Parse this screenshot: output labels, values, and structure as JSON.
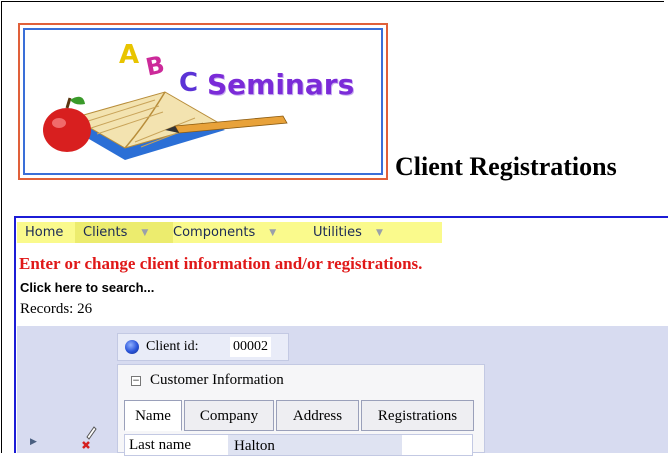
{
  "logo": {
    "letters": [
      "A",
      "B",
      "C"
    ],
    "brand": "Seminars",
    "colors": {
      "a": "#e8c400",
      "b": "#cc2a9a",
      "c": "#5b33d6",
      "brand": "#7b2bd8",
      "border_outer": "#e0603a",
      "border_inner": "#3a6fd8"
    }
  },
  "page_title": "Client Registrations",
  "menu": {
    "items": [
      {
        "label": "Home",
        "has_dropdown": false
      },
      {
        "label": "Clients",
        "has_dropdown": true,
        "selected": true
      },
      {
        "label": "Components",
        "has_dropdown": true
      },
      {
        "label": "Utilities",
        "has_dropdown": true
      }
    ],
    "dropdown_glyph": "▼",
    "background": "#fafa8c"
  },
  "instructions": "Enter or change client information and/or registrations.",
  "search_link": "Click here to search...",
  "records": {
    "label": "Records:",
    "count": "26"
  },
  "record": {
    "client_id_label": "Client id:",
    "client_id_value": "00002",
    "panel": {
      "title": "Customer Information",
      "collapse_glyph": "−",
      "tabs": [
        "Name",
        "Company",
        "Address",
        "Registrations"
      ],
      "active_tab": "Name",
      "fields": [
        {
          "label": "Last name",
          "value": "Halton"
        }
      ]
    }
  },
  "icons": {
    "row_indicator": "▶",
    "edit": "pencil-check-icon"
  },
  "colors": {
    "accent_blue": "#1c1cd6",
    "instruction_red": "#e01818",
    "grid_bg": "#d7dbf0"
  }
}
